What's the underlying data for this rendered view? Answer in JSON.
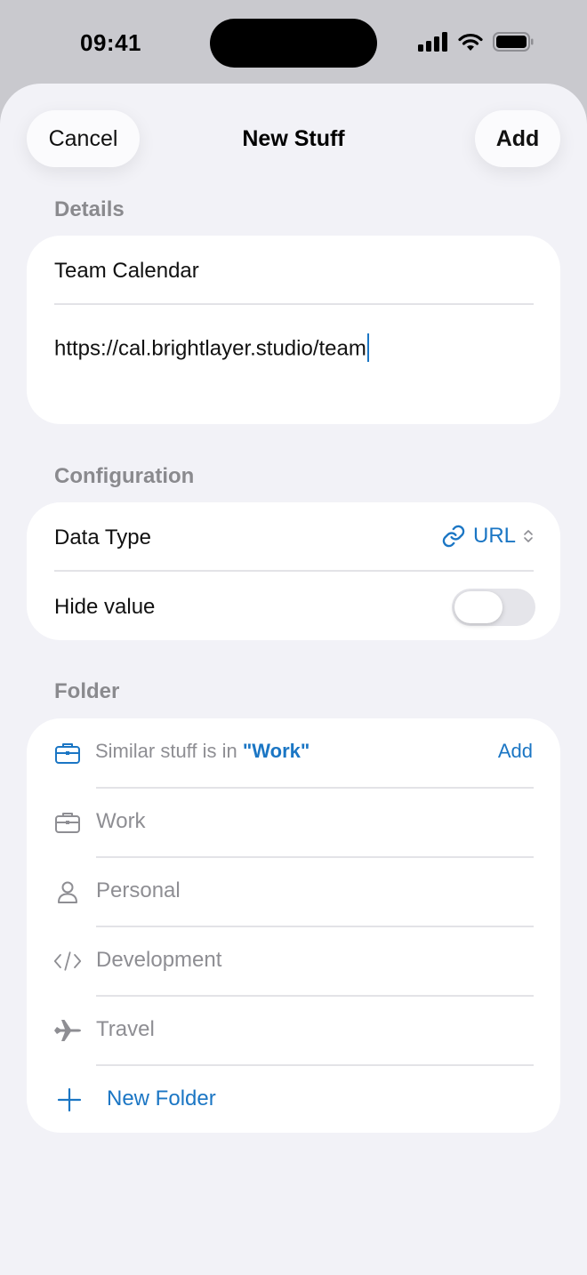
{
  "status_bar": {
    "time": "09:41"
  },
  "nav": {
    "cancel_label": "Cancel",
    "title": "New Stuff",
    "add_label": "Add"
  },
  "details": {
    "section_title": "Details",
    "name_value": "Team Calendar",
    "url_value": "https://cal.brightlayer.studio/team"
  },
  "configuration": {
    "section_title": "Configuration",
    "data_type_label": "Data Type",
    "data_type_value": "URL",
    "data_type_icon": "link-icon",
    "hide_value_label": "Hide value",
    "hide_value_on": false
  },
  "folder": {
    "section_title": "Folder",
    "suggestion": {
      "prefix": "Similar stuff is in ",
      "folder": "\"Work\"",
      "action": "Add",
      "icon": "briefcase-icon"
    },
    "items": [
      {
        "label": "Work",
        "icon": "briefcase-icon"
      },
      {
        "label": "Personal",
        "icon": "person-icon"
      },
      {
        "label": "Development",
        "icon": "code-icon"
      },
      {
        "label": "Travel",
        "icon": "airplane-icon"
      }
    ],
    "new_folder_label": "New Folder",
    "new_folder_icon": "plus-icon"
  },
  "colors": {
    "accent": "#1b76c4",
    "background": "#f2f2f7",
    "secondary_text": "#8e8e93"
  }
}
